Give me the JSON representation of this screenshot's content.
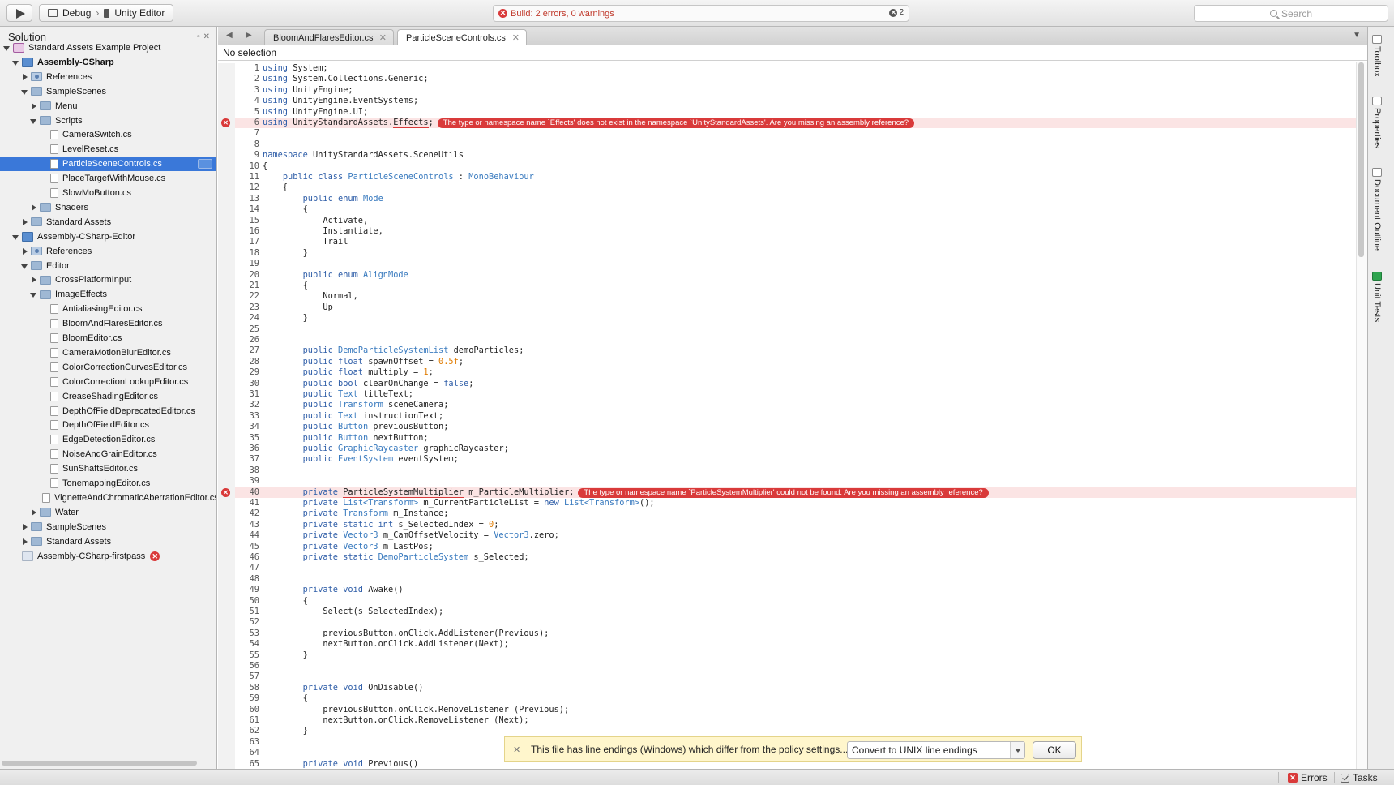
{
  "toolbar": {
    "config": "Debug",
    "breadcrumb_sep": "›",
    "target": "Unity Editor",
    "status_text": "Build: 2 errors, 0 warnings",
    "status_count": "2",
    "search_placeholder": "Search"
  },
  "solution": {
    "title": "Solution",
    "tree": [
      {
        "label": "Standard Assets Example Project",
        "indent": 0,
        "arrow": "down",
        "icon": "solution"
      },
      {
        "label": "Assembly-CSharp",
        "indent": 1,
        "arrow": "down",
        "icon": "project",
        "bold": true
      },
      {
        "label": "References",
        "indent": 2,
        "arrow": "right",
        "icon": "refs"
      },
      {
        "label": "SampleScenes",
        "indent": 2,
        "arrow": "down",
        "icon": "folder"
      },
      {
        "label": "Menu",
        "indent": 3,
        "arrow": "right",
        "icon": "folder"
      },
      {
        "label": "Scripts",
        "indent": 3,
        "arrow": "down",
        "icon": "folder"
      },
      {
        "label": "CameraSwitch.cs",
        "indent": 4,
        "arrow": "none",
        "icon": "file"
      },
      {
        "label": "LevelReset.cs",
        "indent": 4,
        "arrow": "none",
        "icon": "file"
      },
      {
        "label": "ParticleSceneControls.cs",
        "indent": 4,
        "arrow": "none",
        "icon": "file",
        "selected": true
      },
      {
        "label": "PlaceTargetWithMouse.cs",
        "indent": 4,
        "arrow": "none",
        "icon": "file"
      },
      {
        "label": "SlowMoButton.cs",
        "indent": 4,
        "arrow": "none",
        "icon": "file"
      },
      {
        "label": "Shaders",
        "indent": 3,
        "arrow": "right",
        "icon": "folder"
      },
      {
        "label": "Standard Assets",
        "indent": 2,
        "arrow": "right",
        "icon": "folder"
      },
      {
        "label": "Assembly-CSharp-Editor",
        "indent": 1,
        "arrow": "down",
        "icon": "project"
      },
      {
        "label": "References",
        "indent": 2,
        "arrow": "right",
        "icon": "refs"
      },
      {
        "label": "Editor",
        "indent": 2,
        "arrow": "down",
        "icon": "folder"
      },
      {
        "label": "CrossPlatformInput",
        "indent": 3,
        "arrow": "right",
        "icon": "folder"
      },
      {
        "label": "ImageEffects",
        "indent": 3,
        "arrow": "down",
        "icon": "folder"
      },
      {
        "label": "AntialiasingEditor.cs",
        "indent": 4,
        "arrow": "none",
        "icon": "file"
      },
      {
        "label": "BloomAndFlaresEditor.cs",
        "indent": 4,
        "arrow": "none",
        "icon": "file"
      },
      {
        "label": "BloomEditor.cs",
        "indent": 4,
        "arrow": "none",
        "icon": "file"
      },
      {
        "label": "CameraMotionBlurEditor.cs",
        "indent": 4,
        "arrow": "none",
        "icon": "file"
      },
      {
        "label": "ColorCorrectionCurvesEditor.cs",
        "indent": 4,
        "arrow": "none",
        "icon": "file"
      },
      {
        "label": "ColorCorrectionLookupEditor.cs",
        "indent": 4,
        "arrow": "none",
        "icon": "file"
      },
      {
        "label": "CreaseShadingEditor.cs",
        "indent": 4,
        "arrow": "none",
        "icon": "file"
      },
      {
        "label": "DepthOfFieldDeprecatedEditor.cs",
        "indent": 4,
        "arrow": "none",
        "icon": "file"
      },
      {
        "label": "DepthOfFieldEditor.cs",
        "indent": 4,
        "arrow": "none",
        "icon": "file"
      },
      {
        "label": "EdgeDetectionEditor.cs",
        "indent": 4,
        "arrow": "none",
        "icon": "file"
      },
      {
        "label": "NoiseAndGrainEditor.cs",
        "indent": 4,
        "arrow": "none",
        "icon": "file"
      },
      {
        "label": "SunShaftsEditor.cs",
        "indent": 4,
        "arrow": "none",
        "icon": "file"
      },
      {
        "label": "TonemappingEditor.cs",
        "indent": 4,
        "arrow": "none",
        "icon": "file"
      },
      {
        "label": "VignetteAndChromaticAberrationEditor.cs",
        "indent": 4,
        "arrow": "none",
        "icon": "file"
      },
      {
        "label": "Water",
        "indent": 3,
        "arrow": "right",
        "icon": "folder"
      },
      {
        "label": "SampleScenes",
        "indent": 2,
        "arrow": "right",
        "icon": "folder"
      },
      {
        "label": "Standard Assets",
        "indent": 2,
        "arrow": "right",
        "icon": "folder"
      },
      {
        "label": "Assembly-CSharp-firstpass",
        "indent": 1,
        "arrow": "none",
        "icon": "firstpass",
        "error": true
      }
    ]
  },
  "editor": {
    "tabs": [
      {
        "label": "BloomAndFlaresEditor.cs",
        "active": false
      },
      {
        "label": "ParticleSceneControls.cs",
        "active": true
      }
    ],
    "path": "No selection",
    "first_line": 1,
    "lines": [
      [
        [
          "kw",
          "using"
        ],
        [
          "",
          "System;"
        ]
      ],
      [
        [
          "kw",
          "using"
        ],
        [
          "",
          "System.Collections.Generic;"
        ]
      ],
      [
        [
          "kw",
          "using"
        ],
        [
          "",
          "UnityEngine;"
        ]
      ],
      [
        [
          "kw",
          "using"
        ],
        [
          "",
          "UnityEngine.EventSystems;"
        ]
      ],
      [
        [
          "kw",
          "using"
        ],
        [
          "",
          "UnityEngine.UI;"
        ]
      ],
      [
        [
          "kw",
          "using"
        ],
        [
          "",
          "UnityStandardAssets."
        ],
        [
          "squig",
          "Effects"
        ],
        [
          "",
          ";"
        ],
        [
          "bubble",
          "The type or namespace name `Effects' does not exist in the namespace `UnityStandardAssets'. Are you missing an assembly reference?"
        ]
      ],
      [],
      [],
      [
        [
          "kw",
          "namespace"
        ],
        [
          "",
          "UnityStandardAssets.SceneUtils"
        ]
      ],
      [
        [
          "",
          "{"
        ]
      ],
      [
        [
          "",
          "    "
        ],
        [
          "kw",
          "public class"
        ],
        [
          "ty",
          "ParticleSceneControls"
        ],
        [
          "",
          ":"
        ],
        [
          "ty",
          "MonoBehaviour"
        ]
      ],
      [
        [
          "",
          "    {"
        ]
      ],
      [
        [
          "",
          "        "
        ],
        [
          "kw",
          "public enum"
        ],
        [
          "ty",
          "Mode"
        ]
      ],
      [
        [
          "",
          "        {"
        ]
      ],
      [
        [
          "",
          "            Activate,"
        ]
      ],
      [
        [
          "",
          "            Instantiate,"
        ]
      ],
      [
        [
          "",
          "            Trail"
        ]
      ],
      [
        [
          "",
          "        }"
        ]
      ],
      [],
      [
        [
          "",
          "        "
        ],
        [
          "kw",
          "public enum"
        ],
        [
          "ty",
          "AlignMode"
        ]
      ],
      [
        [
          "",
          "        {"
        ]
      ],
      [
        [
          "",
          "            Normal,"
        ]
      ],
      [
        [
          "",
          "            Up"
        ]
      ],
      [
        [
          "",
          "        }"
        ]
      ],
      [],
      [],
      [
        [
          "",
          "        "
        ],
        [
          "kw",
          "public"
        ],
        [
          "ty",
          "DemoParticleSystemList"
        ],
        [
          "",
          "demoParticles;"
        ]
      ],
      [
        [
          "",
          "        "
        ],
        [
          "kw",
          "public float"
        ],
        [
          "",
          "spawnOffset ="
        ],
        [
          "nu",
          "0.5f"
        ],
        [
          "",
          ";"
        ]
      ],
      [
        [
          "",
          "        "
        ],
        [
          "kw",
          "public float"
        ],
        [
          "",
          "multiply ="
        ],
        [
          "nu",
          "1"
        ],
        [
          "",
          ";"
        ]
      ],
      [
        [
          "",
          "        "
        ],
        [
          "kw",
          "public bool"
        ],
        [
          "",
          "clearOnChange ="
        ],
        [
          "kw",
          "false"
        ],
        [
          "",
          ";"
        ]
      ],
      [
        [
          "",
          "        "
        ],
        [
          "kw",
          "public"
        ],
        [
          "ty",
          "Text"
        ],
        [
          "",
          "titleText;"
        ]
      ],
      [
        [
          "",
          "        "
        ],
        [
          "kw",
          "public"
        ],
        [
          "ty",
          "Transform"
        ],
        [
          "",
          "sceneCamera;"
        ]
      ],
      [
        [
          "",
          "        "
        ],
        [
          "kw",
          "public"
        ],
        [
          "ty",
          "Text"
        ],
        [
          "",
          "instructionText;"
        ]
      ],
      [
        [
          "",
          "        "
        ],
        [
          "kw",
          "public"
        ],
        [
          "ty",
          "Button"
        ],
        [
          "",
          "previousButton;"
        ]
      ],
      [
        [
          "",
          "        "
        ],
        [
          "kw",
          "public"
        ],
        [
          "ty",
          "Button"
        ],
        [
          "",
          "nextButton;"
        ]
      ],
      [
        [
          "",
          "        "
        ],
        [
          "kw",
          "public"
        ],
        [
          "ty",
          "GraphicRaycaster"
        ],
        [
          "",
          "graphicRaycaster;"
        ]
      ],
      [
        [
          "",
          "        "
        ],
        [
          "kw",
          "public"
        ],
        [
          "ty",
          "EventSystem"
        ],
        [
          "",
          "eventSystem;"
        ]
      ],
      [],
      [],
      [
        [
          "",
          "        "
        ],
        [
          "kw",
          "private"
        ],
        [
          "squig",
          "ParticleSystemMultiplier"
        ],
        [
          "",
          "m_ParticleMultiplier;"
        ],
        [
          "bubble",
          "The type or namespace name `ParticleSystemMultiplier' could not be found. Are you missing an assembly reference?"
        ]
      ],
      [
        [
          "",
          "        "
        ],
        [
          "kw",
          "private"
        ],
        [
          "ty",
          "List<Transform>"
        ],
        [
          "",
          "m_CurrentParticleList ="
        ],
        [
          "kw",
          "new"
        ],
        [
          "ty",
          "List<Transform>"
        ],
        [
          "",
          "();"
        ]
      ],
      [
        [
          "",
          "        "
        ],
        [
          "kw",
          "private"
        ],
        [
          "ty",
          "Transform"
        ],
        [
          "",
          "m_Instance;"
        ]
      ],
      [
        [
          "",
          "        "
        ],
        [
          "kw",
          "private static int"
        ],
        [
          "",
          "s_SelectedIndex ="
        ],
        [
          "nu",
          "0"
        ],
        [
          "",
          ";"
        ]
      ],
      [
        [
          "",
          "        "
        ],
        [
          "kw",
          "private"
        ],
        [
          "ty",
          "Vector3"
        ],
        [
          "",
          "m_CamOffsetVelocity ="
        ],
        [
          "ty",
          "Vector3"
        ],
        [
          "",
          ".zero;"
        ]
      ],
      [
        [
          "",
          "        "
        ],
        [
          "kw",
          "private"
        ],
        [
          "ty",
          "Vector3"
        ],
        [
          "",
          "m_LastPos;"
        ]
      ],
      [
        [
          "",
          "        "
        ],
        [
          "kw",
          "private static"
        ],
        [
          "ty",
          "DemoParticleSystem"
        ],
        [
          "",
          "s_Selected;"
        ]
      ],
      [],
      [],
      [
        [
          "",
          "        "
        ],
        [
          "kw",
          "private void"
        ],
        [
          "",
          "Awake()"
        ]
      ],
      [
        [
          "",
          "        {"
        ]
      ],
      [
        [
          "",
          "            Select(s_SelectedIndex);"
        ]
      ],
      [],
      [
        [
          "",
          "            previousButton.onClick.AddListener(Previous);"
        ]
      ],
      [
        [
          "",
          "            nextButton.onClick.AddListener(Next);"
        ]
      ],
      [
        [
          "",
          "        }"
        ]
      ],
      [],
      [],
      [
        [
          "",
          "        "
        ],
        [
          "kw",
          "private void"
        ],
        [
          "",
          "OnDisable()"
        ]
      ],
      [
        [
          "",
          "        {"
        ]
      ],
      [
        [
          "",
          "            previousButton.onClick.RemoveListener (Previous);"
        ]
      ],
      [
        [
          "",
          "            nextButton.onClick.RemoveListener (Next);"
        ]
      ],
      [
        [
          "",
          "        }"
        ]
      ],
      [],
      [],
      [
        [
          "",
          "        "
        ],
        [
          "kw",
          "private void"
        ],
        [
          "",
          "Previous()"
        ]
      ]
    ],
    "error_lines": [
      6,
      40
    ]
  },
  "right_pads": [
    "Toolbox",
    "Properties",
    "Document Outline",
    "Unit Tests"
  ],
  "notification": {
    "message": "This file has line endings (Windows) which differ from the policy settings...",
    "option": "Convert to UNIX line endings",
    "ok": "OK"
  },
  "bottom": {
    "errors": "Errors",
    "tasks": "Tasks"
  }
}
